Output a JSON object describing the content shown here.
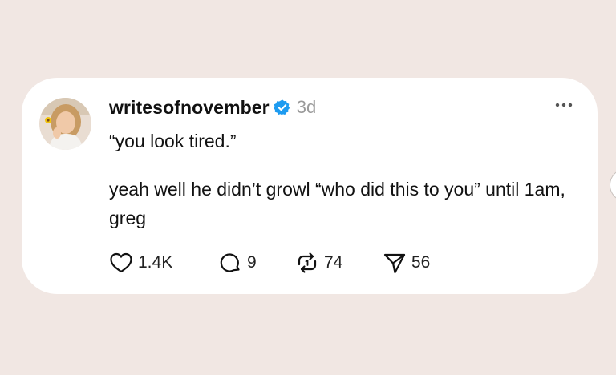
{
  "post": {
    "username": "writesofnovember",
    "verified_icon": "verified-badge-icon",
    "time": "3d",
    "more_icon": "more-options-icon",
    "line1": "“you look tired.”",
    "body": "yeah well he didn’t growl “who did this to you” until 1am, greg",
    "stats": {
      "likes": "1.4K",
      "replies": "9",
      "reposts": "74",
      "shares": "56"
    }
  },
  "colors": {
    "background": "#f1e7e3",
    "card": "#ffffff",
    "verified": "#1d9bf0",
    "muted": "#9a9a9a"
  }
}
